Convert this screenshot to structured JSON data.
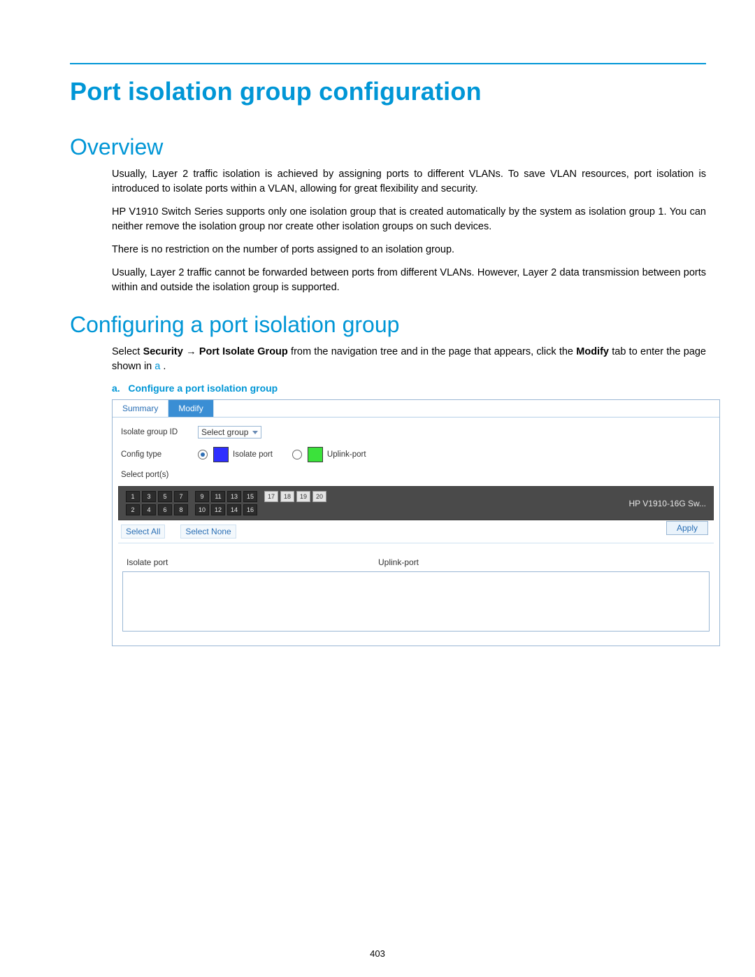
{
  "page": {
    "number": "403",
    "title": "Port isolation group configuration",
    "sections": {
      "overview": {
        "heading": "Overview",
        "paras": [
          "Usually, Layer 2 traffic isolation is achieved by assigning ports to different VLANs. To save VLAN resources, port isolation is introduced to isolate ports within a VLAN, allowing for great flexibility and security.",
          "HP V1910 Switch Series supports only one isolation group that is created automatically by the system as isolation group 1. You can neither remove the isolation group nor create other isolation groups on such devices.",
          "There is no restriction on the number of ports assigned to an isolation group.",
          "Usually, Layer 2 traffic cannot be forwarded between ports from different VLANs. However, Layer 2 data transmission between ports within and outside the isolation group is supported."
        ]
      },
      "configuring": {
        "heading": "Configuring a port isolation group",
        "intro_parts": {
          "pre": "Select ",
          "b1": "Security",
          "arrow": " → ",
          "b2": "Port Isolate Group",
          "mid": " from the navigation tree and in the page that appears, click the ",
          "b3": "Modify",
          "post": " tab to enter the page shown in ",
          "ref": "a",
          "end": "."
        },
        "figure_label_a": "a.",
        "figure_label_text": "Configure a port isolation group"
      }
    }
  },
  "ui": {
    "tabs": {
      "summary": "Summary",
      "modify": "Modify"
    },
    "labels": {
      "isolate_group_id": "Isolate group ID",
      "config_type": "Config type",
      "select_ports": "Select port(s)",
      "isolate_port": "Isolate port",
      "uplink_port": "Uplink-port"
    },
    "select_group": "Select group",
    "colors": {
      "isolate_swatch": "#2e2eff",
      "uplink_swatch": "#3be23b"
    },
    "device_name": "HP V1910-16G Sw...",
    "port_groups": [
      {
        "top": [
          "1",
          "3",
          "5",
          "7"
        ],
        "bottom": [
          "2",
          "4",
          "6",
          "8"
        ],
        "style": "dark"
      },
      {
        "top": [
          "9",
          "11",
          "13",
          "15"
        ],
        "bottom": [
          "10",
          "12",
          "14",
          "16"
        ],
        "style": "dark"
      },
      {
        "top": [
          "17",
          "18",
          "19",
          "20"
        ],
        "bottom": [],
        "style": "light"
      }
    ],
    "buttons": {
      "select_all": "Select All",
      "select_none": "Select None",
      "apply": "Apply"
    },
    "result_headers": {
      "isolate": "Isolate port",
      "uplink": "Uplink-port"
    }
  }
}
